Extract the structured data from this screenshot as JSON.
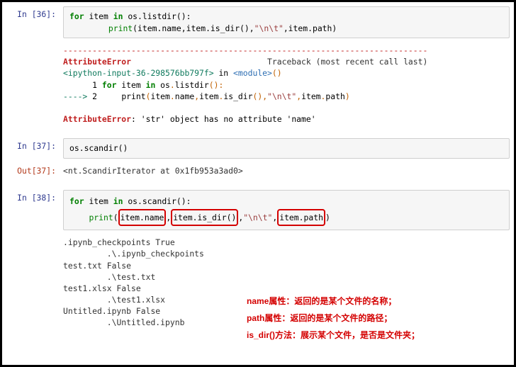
{
  "cell36": {
    "prompt": "In [36]:",
    "code": {
      "l1_for": "for",
      "l1_item": "item",
      "l1_in": "in",
      "l1_os": "os",
      "l1_dot": ".",
      "l1_listdir": "listdir",
      "l1_p": "()",
      "l1_colon": ":",
      "l2_indent": "        ",
      "l2_print": "print",
      "l2_open": "(",
      "l2_a1": "item",
      "l2_d1": ".",
      "l2_a1f": "name",
      "l2_c1": ",",
      "l2_a2": "item",
      "l2_d2": ".",
      "l2_a2f": "is_dir",
      "l2_a2p": "()",
      "l2_c2": ",",
      "l2_str": "\"\\n\\t\"",
      "l2_c3": ",",
      "l2_a3": "item",
      "l2_d3": ".",
      "l2_a3f": "path",
      "l2_close": ")"
    },
    "traceback": {
      "sep": "---------------------------------------------------------------------------",
      "errname": "AttributeError",
      "tbhdr": "Traceback (most recent call last)",
      "loc1a": "<ipython-input-36-298576bb797f>",
      "loc1b": " in ",
      "loc1c": "<module>",
      "loc1d": "()",
      "line1_pre": "      1 ",
      "line1_for": "for",
      "line1_sp1": " item ",
      "line1_in": "in",
      "line1_sp2": " os",
      "line1_dot": ".",
      "line1_fn": "listdir",
      "line1_pp": "()",
      "line1_colon": ":",
      "arrow": "----> ",
      "line2_num": "2",
      "line2_pre": "     ",
      "line2_print": "print",
      "l2o": "(",
      "l2_a1": "item",
      "l2_d1": ".",
      "l2_f1": "name",
      "l2_c1": ",",
      "l2_a2": "item",
      "l2_d2": ".",
      "l2_f2": "is_dir",
      "l2_p2": "()",
      "l2_c2": ",",
      "l2_s": "\"\\n\\t\"",
      "l2_c3": ",",
      "l2_a3": "item",
      "l2_d3": ".",
      "l2_f3": "path",
      "l2c": ")",
      "final_err": "AttributeError",
      "final_msg": ": 'str' object has no attribute 'name'"
    }
  },
  "cell37": {
    "prompt": "In [37]:",
    "code_os": "os",
    "code_dot": ".",
    "code_fn": "scandir",
    "code_p": "()",
    "out_prompt": "Out[37]:",
    "out_text": "<nt.ScandirIterator at 0x1fb953a3ad0>"
  },
  "cell38": {
    "prompt": "In [38]:",
    "code": {
      "l1_for": "for",
      "l1_item": "item",
      "l1_in": "in",
      "l1_os": "os",
      "l1_dot": ".",
      "l1_scandir": "scandir",
      "l1_p": "()",
      "l1_colon": ":",
      "l2_indent": "    ",
      "l2_print": "print",
      "l2_open": "(",
      "box1": "item.name",
      "l2_c1": ",",
      "box2": "item.is_dir()",
      "l2_c2": ",",
      "l2_str": "\"\\n\\t\"",
      "l2_c3": ",",
      "box3": "item.path",
      "l2_close": ")"
    },
    "output": ".ipynb_checkpoints True \n\t .\\.ipynb_checkpoints\ntest.txt False \n\t .\\test.txt\ntest1.xlsx False \n\t .\\test1.xlsx\nUntitled.ipynb False \n\t .\\Untitled.ipynb"
  },
  "annotations": {
    "a1": "name属性：返回的是某个文件的名称；",
    "a2": "path属性：返回的是某个文件的路径；",
    "a3": "is_dir()方法：展示某个文件，是否是文件夹；"
  }
}
